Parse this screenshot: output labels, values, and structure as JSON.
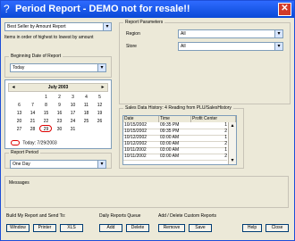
{
  "window": {
    "title": "Period Report - DEMO not for resale!!"
  },
  "report": {
    "selector_value": "Best Seller by Amount Report",
    "description": "Items in order of highest to lowest by amount"
  },
  "beginning": {
    "label": "Beginning Date of Report",
    "selected": "Today"
  },
  "calendar": {
    "month": "July 2003",
    "days_of_week": [
      "S",
      "M",
      "T",
      "W",
      "T",
      "F",
      "S"
    ],
    "weeks": [
      [
        "",
        "",
        "1",
        "2",
        "3",
        "4",
        "5"
      ],
      [
        "6",
        "7",
        "8",
        "9",
        "10",
        "11",
        "12"
      ],
      [
        "13",
        "14",
        "15",
        "16",
        "17",
        "18",
        "19"
      ],
      [
        "20",
        "21",
        "22",
        "23",
        "24",
        "25",
        "26"
      ],
      [
        "27",
        "28",
        "29",
        "30",
        "31",
        "",
        ""
      ]
    ],
    "today_text": "Today: 7/29/2003"
  },
  "period": {
    "label": "Report Period",
    "selected": "One Day"
  },
  "params": {
    "group_label": "Report Parameters",
    "region_label": "Region",
    "region_value": "All",
    "store_label": "Store",
    "store_value": "All"
  },
  "history": {
    "group_label": "Sales Data History: 4 Reading from PLU/SalesHistory",
    "columns": [
      "Date",
      "Time",
      "Profit Center"
    ],
    "rows": [
      [
        "10/15/2002",
        "09:35 PM",
        "1"
      ],
      [
        "10/15/2002",
        "09:35 PM",
        "2"
      ],
      [
        "10/12/2002",
        "03:00 AM",
        "1"
      ],
      [
        "10/12/2002",
        "03:00 AM",
        "2"
      ],
      [
        "10/11/2002",
        "03:00 AM",
        "1"
      ],
      [
        "10/11/2002",
        "03:00 AM",
        "2"
      ]
    ]
  },
  "messages": {
    "label": "Messages"
  },
  "footer": {
    "build_label": "Build My Report and Send To:",
    "queue_label": "Daily Reports Queue",
    "custom_label": "Add / Delete Custom Reports",
    "buttons": {
      "window": "Window",
      "printer": "Printer",
      "xls": "XLS",
      "add": "Add",
      "delete": "Delete",
      "remove": "Remove",
      "save": "Save",
      "help": "Help",
      "close": "Close"
    }
  }
}
